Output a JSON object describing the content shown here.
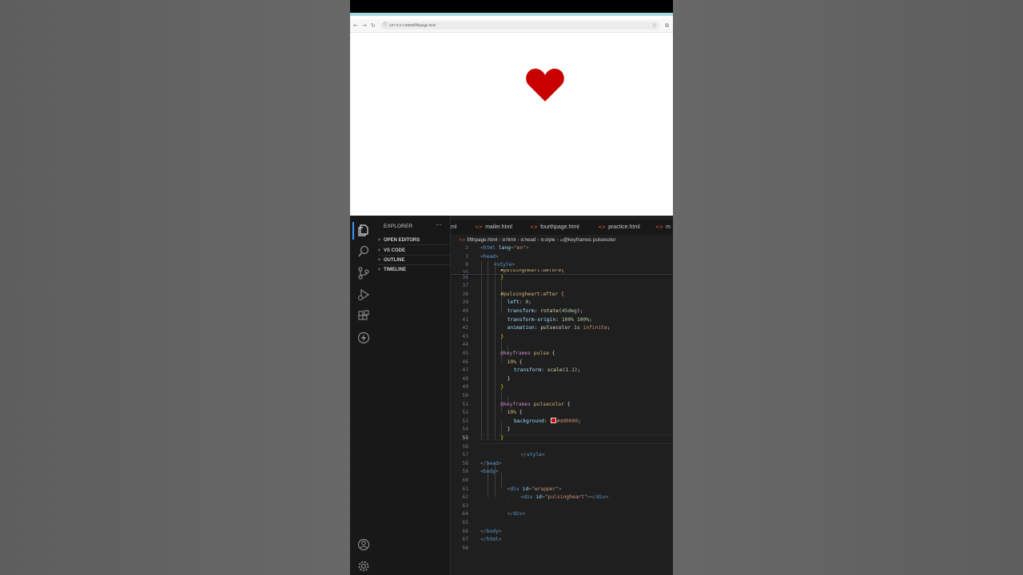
{
  "browser": {
    "url": "127.0.0.1:5500/fifthpage.html",
    "nav_back": "←",
    "nav_forward": "→",
    "nav_reload": "↻",
    "url_icon": "ⓘ",
    "bookmark": "☆",
    "extension": "⧉",
    "heart_color": "#c80000"
  },
  "vscode": {
    "explorer_title": "EXPLORER",
    "more": "···",
    "sections": [
      "OPEN EDITORS",
      "VS CODE",
      "OUTLINE",
      "TIMELINE"
    ],
    "tabs": [
      {
        "label": "ml",
        "icon": ""
      },
      {
        "label": "mailer.html",
        "icon": "<>"
      },
      {
        "label": "fourthpage.html",
        "icon": "<>"
      },
      {
        "label": "practice.html",
        "icon": "<>"
      },
      {
        "label": "m",
        "icon": "<>"
      }
    ],
    "breadcrumb": {
      "file": "fifthpage.html",
      "items": [
        "html",
        "head",
        "style",
        "@keyframes pulsecolor"
      ]
    },
    "activity_icons": [
      "explorer-icon",
      "search-icon",
      "source-control-icon",
      "run-debug-icon",
      "extensions-icon",
      "lightning-icon",
      "account-icon",
      "settings-gear-icon"
    ],
    "line_numbers": [
      "2",
      "3",
      "8",
      "35",
      "36",
      "37",
      "38",
      "39",
      "40",
      "41",
      "42",
      "43",
      "44",
      "45",
      "46",
      "47",
      "48",
      "49",
      "50",
      "51",
      "52",
      "53",
      "54",
      "55",
      "56",
      "57",
      "58",
      "59",
      "60",
      "61",
      "62",
      "63",
      "64",
      "65",
      "66",
      "67",
      "68"
    ],
    "current_line": "55",
    "code": {
      "l2": [
        "<",
        "html",
        " lang",
        "=",
        "\"en\"",
        ">"
      ],
      "l3": [
        "<",
        "head",
        ">"
      ],
      "l8": [
        "<",
        "style",
        ">"
      ],
      "l35": "#pulsingheart:before{",
      "l36": "}",
      "l38": "#pulsingheart:after {",
      "l39": [
        "left",
        ": ",
        "0",
        ";"
      ],
      "l40": [
        "transform",
        ": ",
        "rotate",
        "(",
        "45deg",
        ");"
      ],
      "l41": [
        "transform-origin",
        ": ",
        "100% 100%",
        ";"
      ],
      "l42": [
        "animation",
        ": ",
        "pulsecolor",
        " ",
        "1s",
        " ",
        "infinite",
        ";"
      ],
      "l43": "}",
      "l45": [
        "@keyframes",
        " ",
        "pulse",
        " {"
      ],
      "l46": [
        "10%",
        " {"
      ],
      "l47": [
        "transform",
        ": ",
        "scale",
        "(",
        "1.1",
        ");"
      ],
      "l48": "}",
      "l49": "}",
      "l51": [
        "@keyframes",
        " ",
        "pulsecolor",
        " {"
      ],
      "l52": [
        "10%",
        " {"
      ],
      "l53": [
        "background",
        ": ",
        "#dd0000",
        ";"
      ],
      "l54": "}",
      "l55": "}",
      "l57": [
        "</",
        "style",
        ">"
      ],
      "l58": [
        "</",
        "head",
        ">"
      ],
      "l59": [
        "<",
        "body",
        ">"
      ],
      "l61": [
        "<",
        "div",
        " id",
        "=",
        "\"wrapper\"",
        ">"
      ],
      "l62": [
        "<",
        "div",
        " id",
        "=",
        "\"pulsingheart\"",
        "></",
        "div",
        ">"
      ],
      "l64": [
        "</",
        "div",
        ">"
      ],
      "l66": [
        "</",
        "body",
        ">"
      ],
      "l67": [
        "</",
        "html",
        ">"
      ]
    }
  }
}
